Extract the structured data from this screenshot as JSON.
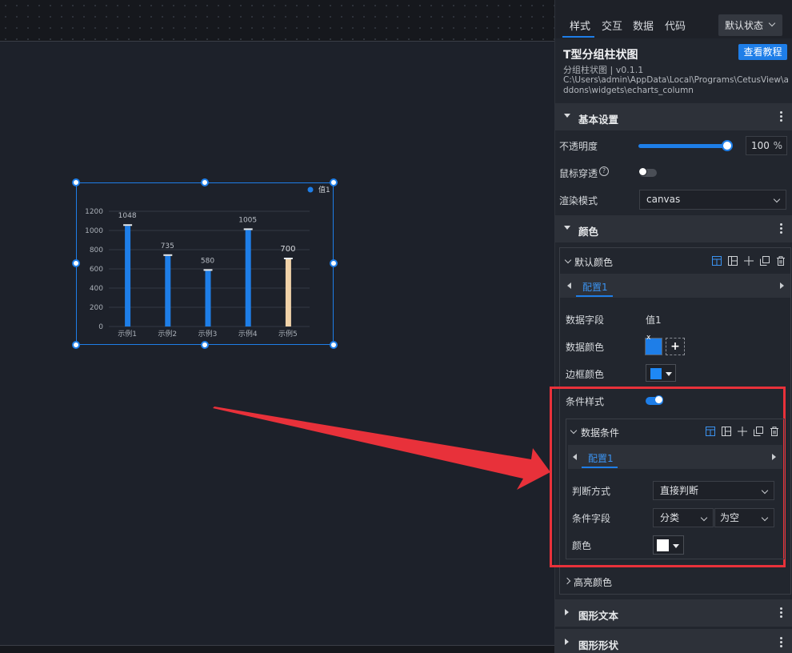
{
  "panel": {
    "tabs": [
      "样式",
      "交互",
      "数据",
      "代码"
    ],
    "state_select": "默认状态",
    "widget_title": "T型分组柱状图",
    "tutorial_button": "查看教程",
    "widget_subtitle": "分组柱状图 | v0.1.1",
    "widget_path": "C:\\Users\\admin\\AppData\\Local\\Programs\\CetusView\\addons\\widgets\\echarts_column",
    "basic": {
      "title": "基本设置",
      "opacity_label": "不透明度",
      "opacity_value": "100",
      "opacity_unit": "%",
      "opacity_level": 1.0,
      "mouse_through_label": "鼠标穿透",
      "help_icon": "?",
      "render_mode_label": "渲染模式",
      "render_mode_value": "canvas"
    },
    "color": {
      "title": "颜色",
      "default_color": {
        "title": "默认颜色",
        "config_tab": "配置1",
        "data_field_label": "数据字段",
        "data_field_value": "值1",
        "data_color_label": "数据颜色",
        "data_color": "#1e7ee8",
        "border_color_label": "边框颜色",
        "border_color": "#1e88f5",
        "cond_style_label": "条件样式",
        "add_glyph": "+",
        "remove_glyph": "x",
        "condition": {
          "title": "数据条件",
          "config_tab": "配置1",
          "judge_label": "判断方式",
          "judge_value": "直接判断",
          "field_label": "条件字段",
          "field_value": "分类",
          "op_value": "为空",
          "color_label": "颜色",
          "color": "#ffffff"
        }
      },
      "highlight_title": "高亮颜色"
    },
    "shape_text_title": "图形文本",
    "shape_form_title": "图形形状"
  },
  "colors": {
    "accent": "#1e7ee8",
    "highlight_bar": "#f0d2a8",
    "annotation_arrow": "#e8313a"
  },
  "chart_data": {
    "type": "bar",
    "categories": [
      "示例1",
      "示例2",
      "示例3",
      "示例4",
      "示例5"
    ],
    "series": [
      {
        "name": "值1",
        "values": [
          1048,
          735,
          580,
          1005,
          700
        ]
      }
    ],
    "data_labels": [
      "1048",
      "735",
      "580",
      "1005",
      "700"
    ],
    "bar_colors": [
      "#1e7ee8",
      "#1e7ee8",
      "#1e7ee8",
      "#1e7ee8",
      "#f0d2a8"
    ],
    "yticks": [
      "0",
      "200",
      "400",
      "600",
      "800",
      "1000",
      "1200"
    ],
    "ylim": [
      0,
      1200
    ],
    "legend": "top-right",
    "grid": true
  }
}
